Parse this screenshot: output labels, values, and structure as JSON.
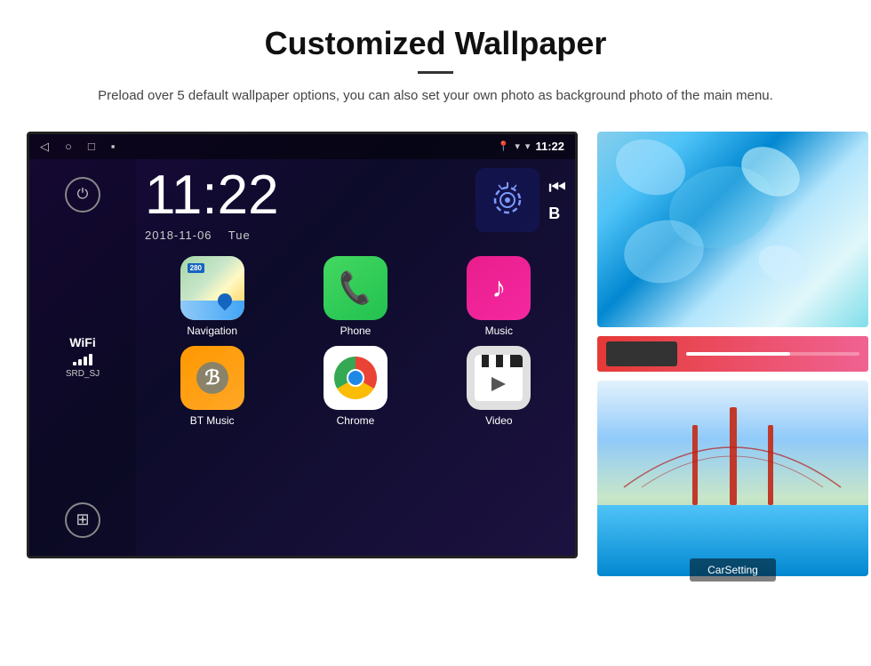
{
  "header": {
    "title": "Customized Wallpaper",
    "subtitle": "Preload over 5 default wallpaper options, you can also set your own photo as background photo of the main menu."
  },
  "android": {
    "statusBar": {
      "time": "11:22",
      "navIcons": [
        "◁",
        "○",
        "□",
        "▪"
      ],
      "statusIcons": [
        "location",
        "wifi",
        "signal"
      ]
    },
    "clock": {
      "time": "11:22",
      "date": "2018-11-06",
      "day": "Tue"
    },
    "wifi": {
      "label": "WiFi",
      "ssid": "SRD_SJ"
    },
    "apps": [
      {
        "label": "Navigation",
        "type": "navigation"
      },
      {
        "label": "Phone",
        "type": "phone"
      },
      {
        "label": "Music",
        "type": "music"
      },
      {
        "label": "BT Music",
        "type": "bt"
      },
      {
        "label": "Chrome",
        "type": "chrome"
      },
      {
        "label": "Video",
        "type": "video"
      }
    ],
    "wallpapers": [
      {
        "type": "ice",
        "label": ""
      },
      {
        "type": "bridge",
        "label": "CarSetting"
      }
    ]
  }
}
